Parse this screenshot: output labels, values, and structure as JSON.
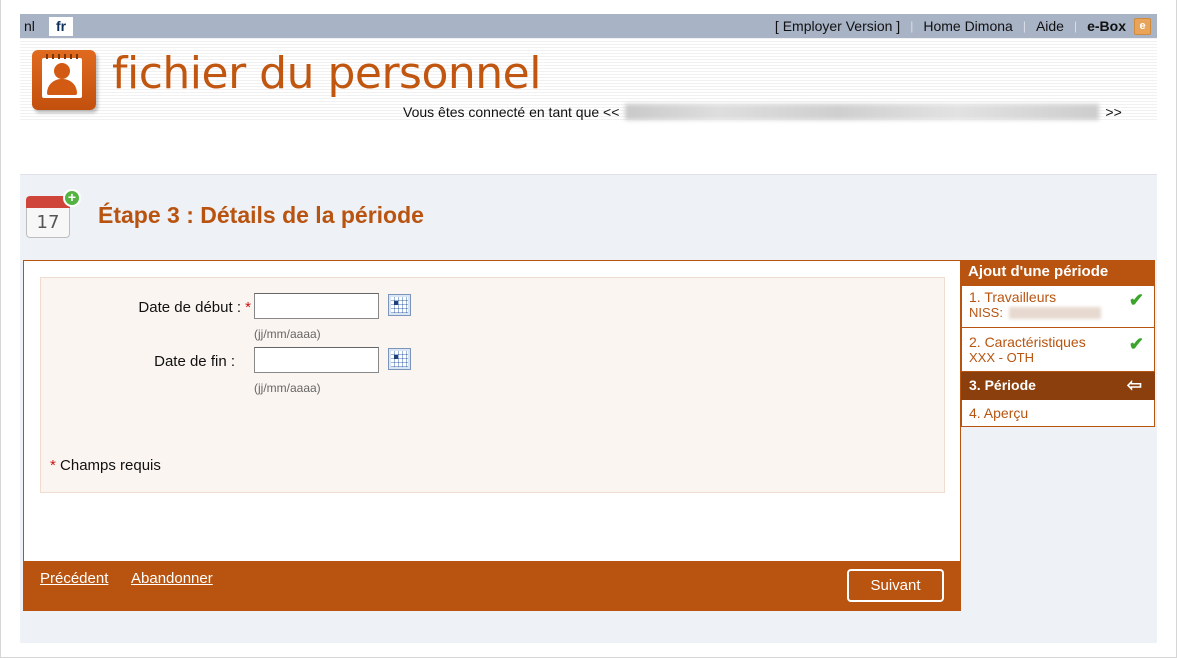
{
  "header": {
    "lang_nl": "nl",
    "lang_fr": "fr",
    "links": {
      "employer": "[ Employer Version ]",
      "home": "Home Dimona",
      "aide": "Aide",
      "ebox": "e-Box",
      "sep": "|"
    },
    "ebox_icon": "e"
  },
  "banner": {
    "app_title": "fichier du personnel",
    "connected_prefix": "Vous êtes connecté en tant que <<",
    "connected_suffix": ">>"
  },
  "step": {
    "calendar_day": "17",
    "plus": "+",
    "title": "Étape 3 : Détails de la période"
  },
  "form": {
    "start_label": "Date de début :",
    "start_value": "",
    "start_hint": "(jj/mm/aaaa)",
    "end_label": "Date de fin :",
    "end_value": "",
    "end_hint": "(jj/mm/aaaa)",
    "required_mark": "*",
    "required_note": "Champs requis"
  },
  "footer": {
    "previous": "Précédent",
    "cancel": "Abandonner",
    "next": "Suivant"
  },
  "sidenav": {
    "title": "Ajout d'une période",
    "items": [
      {
        "label": "1. Travailleurs",
        "sub": "NISS:",
        "status": "✔"
      },
      {
        "label": "2. Caractéristiques",
        "sub": "XXX  -  OTH",
        "status": "✔"
      },
      {
        "label": "3. Période",
        "status": "⇦"
      },
      {
        "label": "4. Aperçu"
      }
    ]
  },
  "colors": {
    "accent": "#b85410",
    "topbar": "#a8b4c6",
    "active": "#8b3f0c",
    "check": "#3aa52a"
  },
  "icons": [
    "user-card-icon",
    "calendar-add-icon",
    "calendar-picker-icon",
    "check-icon",
    "arrow-left-icon",
    "ebox-icon"
  ]
}
